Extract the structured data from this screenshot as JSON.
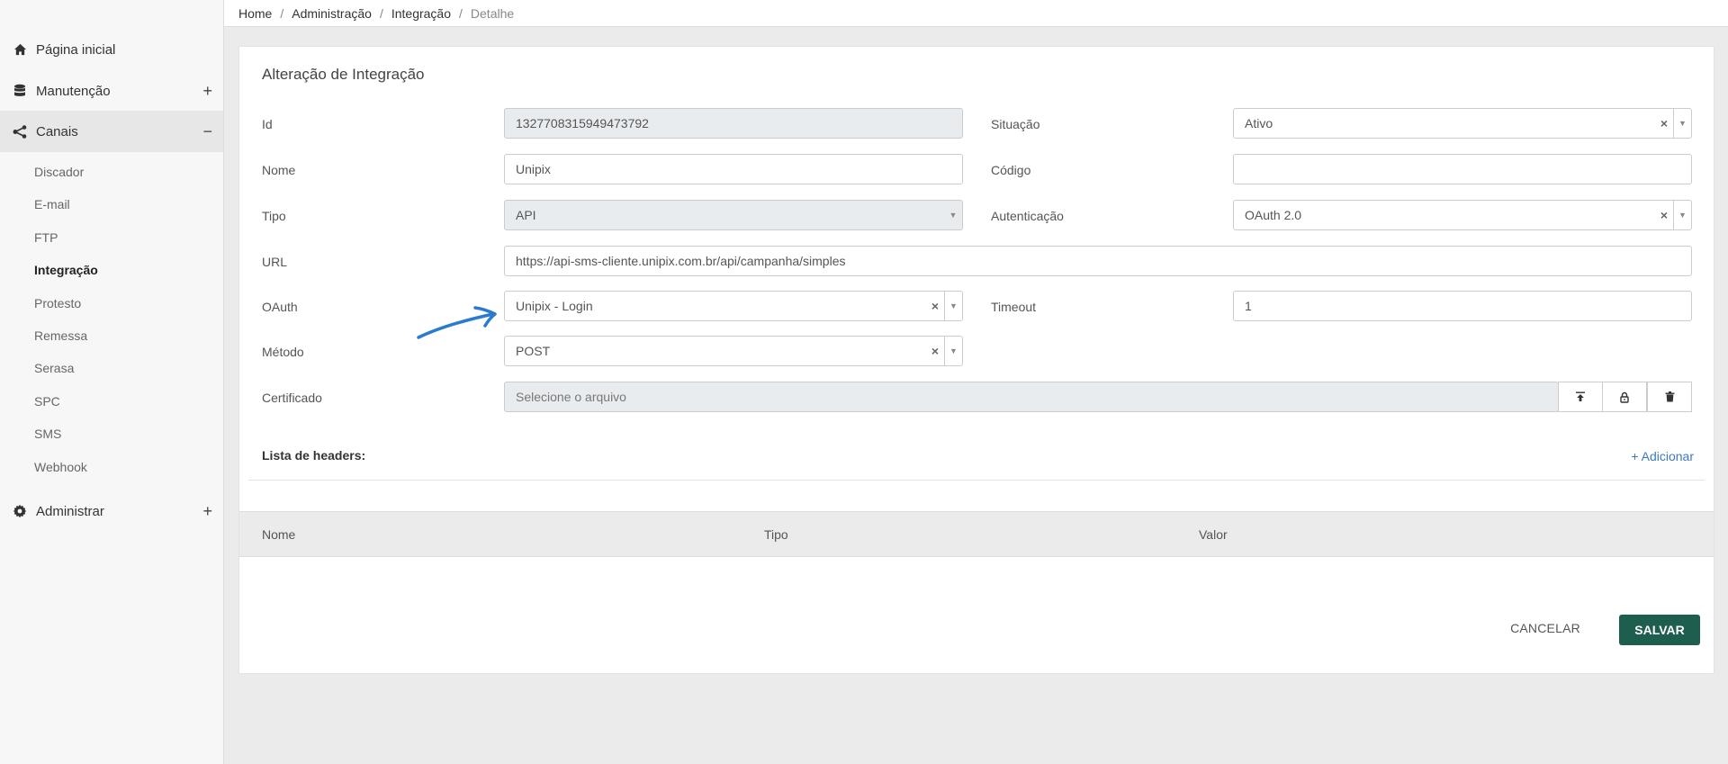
{
  "breadcrumb": [
    "Home",
    "Administração",
    "Integração",
    "Detalhe"
  ],
  "sidebar": {
    "items": [
      {
        "label": "Página inicial",
        "icon": "home-icon"
      },
      {
        "label": "Manutenção",
        "icon": "database-icon",
        "toggle": "+"
      },
      {
        "label": "Canais",
        "icon": "share-icon",
        "toggle": "−"
      },
      {
        "label": "Administrar",
        "icon": "gear-icon",
        "toggle": "+"
      }
    ],
    "subitems": [
      "Discador",
      "E-mail",
      "FTP",
      "Integração",
      "Protesto",
      "Remessa",
      "Serasa",
      "SPC",
      "SMS",
      "Webhook"
    ],
    "active_subitem": "Integração"
  },
  "form": {
    "title": "Alteração de Integração",
    "id": {
      "label": "Id",
      "value": "1327708315949473792"
    },
    "situacao": {
      "label": "Situação",
      "value": "Ativo"
    },
    "nome": {
      "label": "Nome",
      "value": "Unipix"
    },
    "codigo": {
      "label": "Código",
      "value": ""
    },
    "tipo": {
      "label": "Tipo",
      "value": "API"
    },
    "autenticacao": {
      "label": "Autenticação",
      "value": "OAuth 2.0"
    },
    "url": {
      "label": "URL",
      "value": "https://api-sms-cliente.unipix.com.br/api/campanha/simples"
    },
    "oauth": {
      "label": "OAuth",
      "value": "Unipix - Login"
    },
    "timeout": {
      "label": "Timeout",
      "value": "1"
    },
    "metodo": {
      "label": "Método",
      "value": "POST"
    },
    "certificado": {
      "label": "Certificado",
      "placeholder": "Selecione o arquivo"
    }
  },
  "headers": {
    "title": "Lista de headers:",
    "add_label": "+ Adicionar",
    "columns": [
      "Nome",
      "Tipo",
      "Valor"
    ]
  },
  "actions": {
    "cancel": "Cancelar",
    "save": "SALVAR"
  },
  "colors": {
    "primary": "#1d5e4f",
    "link": "#3a7bbf",
    "annotation": "#2a7ad0"
  }
}
